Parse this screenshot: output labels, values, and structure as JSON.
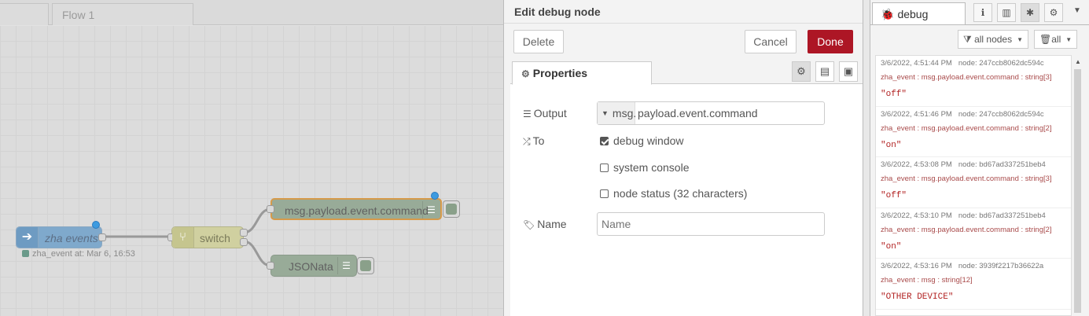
{
  "workspace": {
    "tabs": [
      "",
      "Flow 1"
    ],
    "nodes": {
      "zha": {
        "label": "zha events",
        "status": "zha_event at: Mar 6, 16:53"
      },
      "switch": {
        "label": "switch"
      },
      "debug": {
        "label": "msg.payload.event.command"
      },
      "jsonata": {
        "label": "JSONata"
      }
    }
  },
  "edit": {
    "title": "Edit debug node",
    "delete_label": "Delete",
    "cancel_label": "Cancel",
    "done_label": "Done",
    "tab_properties": "Properties",
    "output_label": "Output",
    "output_prefix": "msg.",
    "output_value": "payload.event.command",
    "to_label": "To",
    "opt_debug": "debug window",
    "opt_console": "system console",
    "opt_status": "node status (32 characters)",
    "name_label": "Name",
    "name_placeholder": "Name",
    "checks": {
      "debug": true,
      "console": false,
      "status": false
    }
  },
  "sidebar": {
    "tab_label": "debug",
    "filter_nodes": "all nodes",
    "filter_clear": "all",
    "messages": [
      {
        "time": "3/6/2022, 4:51:44 PM",
        "node": "node: 247ccb8062dc594c",
        "topic": "zha_event : msg.payload.event.command : string[3]",
        "payload": "\"off\""
      },
      {
        "time": "3/6/2022, 4:51:46 PM",
        "node": "node: 247ccb8062dc594c",
        "topic": "zha_event : msg.payload.event.command : string[2]",
        "payload": "\"on\""
      },
      {
        "time": "3/6/2022, 4:53:08 PM",
        "node": "node: bd67ad337251beb4",
        "topic": "zha_event : msg.payload.event.command : string[3]",
        "payload": "\"off\""
      },
      {
        "time": "3/6/2022, 4:53:10 PM",
        "node": "node: bd67ad337251beb4",
        "topic": "zha_event : msg.payload.event.command : string[2]",
        "payload": "\"on\""
      },
      {
        "time": "3/6/2022, 4:53:16 PM",
        "node": "node: 3939f2217b36622a",
        "topic": "zha_event : msg : string[12]",
        "payload": "\"OTHER DEVICE\""
      }
    ]
  },
  "colors": {
    "done": "#ad1625",
    "payload": "#b22222",
    "topic": "#a94b4b",
    "node_debug": "#98ab98",
    "node_zha": "#7fa9cc",
    "node_switch": "#d0d0a0"
  }
}
